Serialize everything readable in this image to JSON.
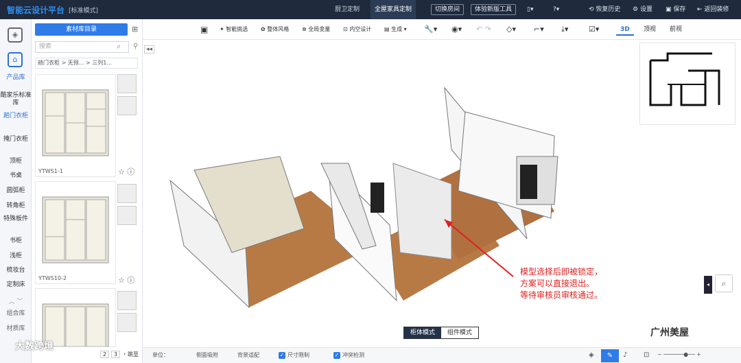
{
  "header": {
    "brand": "智能云设计平台",
    "mode_label": "[标准模式]",
    "tabs": [
      "厨卫定制",
      "全屋家具定制"
    ],
    "buttons": [
      "切换房间",
      "体验新版工具"
    ],
    "icons": {
      "undo_history": "恢复历史",
      "settings": "设置",
      "save": "保存",
      "exit": "返回装修"
    }
  },
  "nav": {
    "product_lib": "产品库",
    "categories": [
      "酷家乐标准库",
      "趟门衣柜",
      "掩门衣柜",
      "顶柜",
      "书桌",
      "圆弧柜",
      "转角柜",
      "特殊板件",
      "书柜",
      "浅柜",
      "梳妆台",
      "定制床"
    ],
    "group_lib": "组合库",
    "material_lib": "材质库"
  },
  "panel": {
    "lib_button": "素材库目录",
    "search_placeholder": "搜索",
    "breadcrumb": "趟门衣柜 > 无预... > 三列1...",
    "items": [
      {
        "name": "YTWS1-1"
      },
      {
        "name": "YTWS10-2"
      }
    ],
    "pager": {
      "pages": [
        "2",
        "3"
      ],
      "jump": "跳至"
    }
  },
  "toolbar": {
    "tools": [
      "智能挑选",
      "整体风格",
      "全局变量",
      "内空设计",
      "生成"
    ],
    "views": [
      "3D",
      "顶视",
      "前视"
    ]
  },
  "viewport": {
    "annotation": [
      "模型选择后即被锁定，",
      "方案可以直接退出。",
      "等待审核员审核通过。"
    ],
    "modes": [
      "柜体模式",
      "组件模式"
    ]
  },
  "status": {
    "unit_label": "单位：",
    "items": [
      "侧面吸附",
      "背景适配",
      "尺寸限制",
      "冲突检测"
    ]
  },
  "watermarks": [
    "大数跨境",
    "广州美屋"
  ]
}
